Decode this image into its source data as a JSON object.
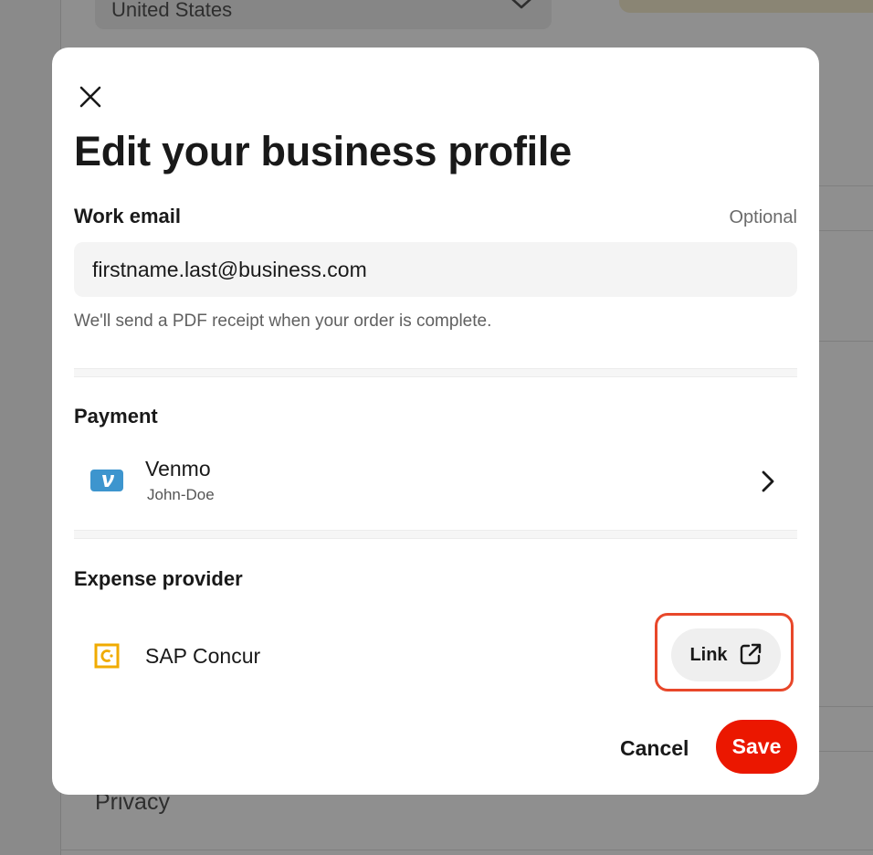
{
  "background": {
    "country_value": "United States",
    "footer_link": "Privacy"
  },
  "modal": {
    "title": "Edit your business profile",
    "close_icon": "close-icon",
    "work_email": {
      "label": "Work email",
      "optional_label": "Optional",
      "value": "firstname.last@business.com",
      "helper": "We'll send a PDF receipt when your order is complete."
    },
    "payment": {
      "label": "Payment",
      "method_name": "Venmo",
      "method_user": "John-Doe",
      "logo_icon": "venmo-logo-icon",
      "chevron_icon": "chevron-right-icon"
    },
    "expense": {
      "label": "Expense provider",
      "provider_name": "SAP Concur",
      "logo_icon": "sap-concur-logo-icon",
      "link_label": "Link",
      "link_icon": "external-link-icon"
    },
    "actions": {
      "cancel_label": "Cancel",
      "save_label": "Save"
    }
  },
  "colors": {
    "accent_red": "#eb1700",
    "highlight_border": "#e8472a",
    "venmo_blue": "#3d95ce",
    "concur_gold": "#f0ab00",
    "input_bg": "#f4f4f4"
  }
}
